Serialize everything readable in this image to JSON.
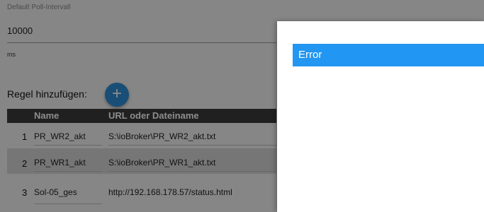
{
  "settings": {
    "poll_interval_label": "Default Poll-Intervall",
    "poll_interval_value": "10000",
    "poll_interval_unit": "ms"
  },
  "rules": {
    "add_label": "Regel hinzufügen:",
    "add_button_glyph": "+",
    "columns": {
      "name": "Name",
      "url": "URL oder Dateiname"
    },
    "rows": [
      {
        "num": "1",
        "name": "PR_WR2_akt",
        "url": "S:\\ioBroker\\PR_WR2_akt.txt"
      },
      {
        "num": "2",
        "name": "PR_WR1_akt",
        "url": "S:\\ioBroker\\PR_WR1_akt.txt"
      },
      {
        "num": "3",
        "name": "Sol-05_ges",
        "url": "http://192.168.178.57/status.html"
      }
    ]
  },
  "dialog": {
    "title": "Error"
  },
  "colors": {
    "accent": "#2f8fd8",
    "dialog_header": "#2196f3",
    "table_header": "#3b3b3b"
  }
}
